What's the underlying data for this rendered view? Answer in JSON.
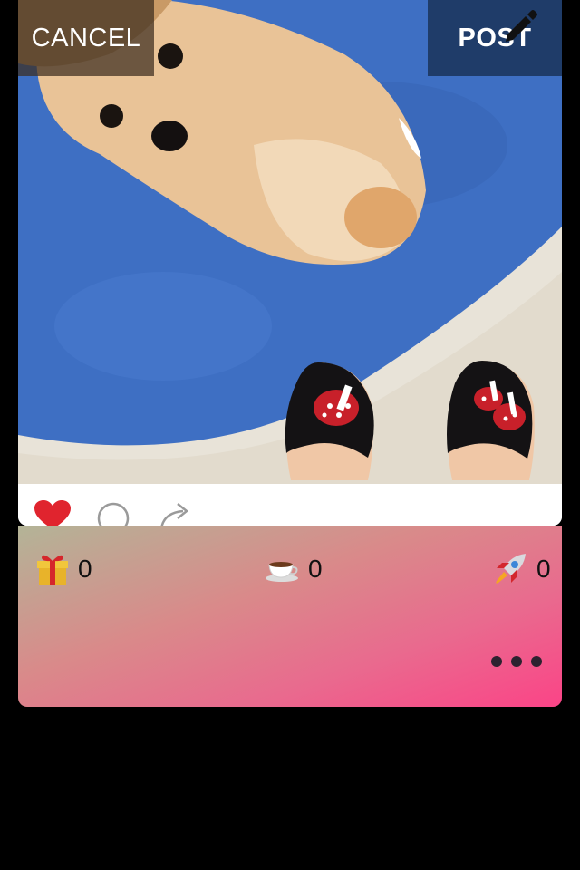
{
  "top_bar": {
    "cancel_label": "CANCEL",
    "post_label": "POST",
    "edit_icon": "pencil-icon"
  },
  "post": {
    "image_description_icon": "photo",
    "actions": {
      "like_icon": "heart-icon",
      "like_color": "#e0242e",
      "comment_icon": "comment-bubble-icon",
      "share_icon": "share-arrow-icon"
    }
  },
  "reactions": {
    "gift": {
      "icon": "gift-icon",
      "count": "0"
    },
    "coffee": {
      "icon": "coffee-cup-icon",
      "count": "0"
    },
    "rocket": {
      "icon": "rocket-icon",
      "count": "0"
    },
    "more_icon": "more-dots-icon"
  },
  "colors": {
    "background": "#000000",
    "panel_gradient_start": "#b3b497",
    "panel_gradient_end": "#fb4487"
  }
}
